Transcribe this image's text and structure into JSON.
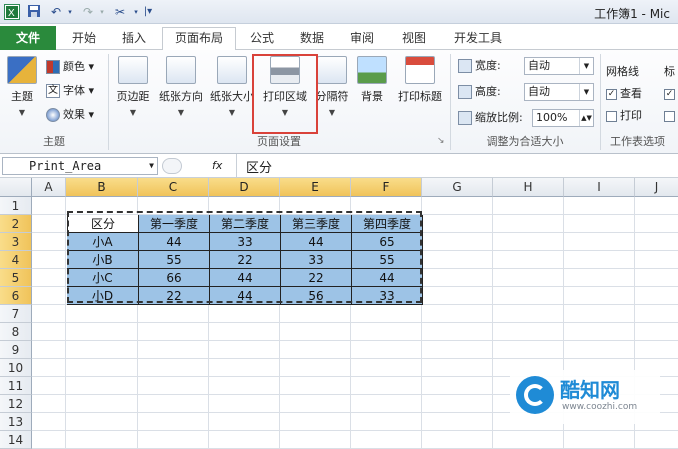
{
  "titlebar": {
    "title": "工作簿1 - Mic",
    "save_icon": "save-icon",
    "undo_icon": "undo-icon",
    "redo_icon": "redo-icon"
  },
  "tabs": [
    "文件",
    "开始",
    "插入",
    "页面布局",
    "公式",
    "数据",
    "审阅",
    "视图",
    "开发工具"
  ],
  "active_tab": "页面布局",
  "ribbon": {
    "theme_group": {
      "main": "主题",
      "colors": "颜色",
      "fonts": "字体",
      "effects": "效果",
      "label": "主题"
    },
    "page_setup": {
      "margins": "页边距",
      "orientation": "纸张方向",
      "size": "纸张大小",
      "print_area": "打印区域",
      "breaks": "分隔符",
      "background": "背景",
      "print_titles": "打印标题",
      "label": "页面设置"
    },
    "scale_group": {
      "width_label": "宽度:",
      "width_value": "自动",
      "height_label": "高度:",
      "height_value": "自动",
      "scale_label": "缩放比例:",
      "scale_value": "100%",
      "label": "调整为合适大小"
    },
    "sheet_options": {
      "gridlines": "网格线",
      "headings_short": "标",
      "view": "查看",
      "print": "打印",
      "label": "工作表选项"
    },
    "highlight_color": "#d9423a"
  },
  "formula_bar": {
    "name_box": "Print_Area",
    "fx": "fx",
    "content": "区分"
  },
  "columns": [
    "A",
    "B",
    "C",
    "D",
    "E",
    "F",
    "G",
    "H",
    "I",
    "J"
  ],
  "rows": [
    "1",
    "2",
    "3",
    "4",
    "5",
    "6",
    "7",
    "8",
    "9",
    "10",
    "11",
    "12",
    "13",
    "14"
  ],
  "table": {
    "header": [
      "区分",
      "第一季度",
      "第二季度",
      "第三季度",
      "第四季度"
    ],
    "rows": [
      [
        "小A",
        "44",
        "33",
        "44",
        "65"
      ],
      [
        "小B",
        "55",
        "22",
        "33",
        "55"
      ],
      [
        "小C",
        "66",
        "44",
        "22",
        "44"
      ],
      [
        "小D",
        "22",
        "44",
        "56",
        "33"
      ]
    ]
  },
  "watermark": {
    "name": "酷知网",
    "url": "www.coozhi.com"
  },
  "colors": {
    "file_tab": "#2a8a3c",
    "cell_fill": "#9dc3e6",
    "selected_header": "#f0c35a"
  }
}
